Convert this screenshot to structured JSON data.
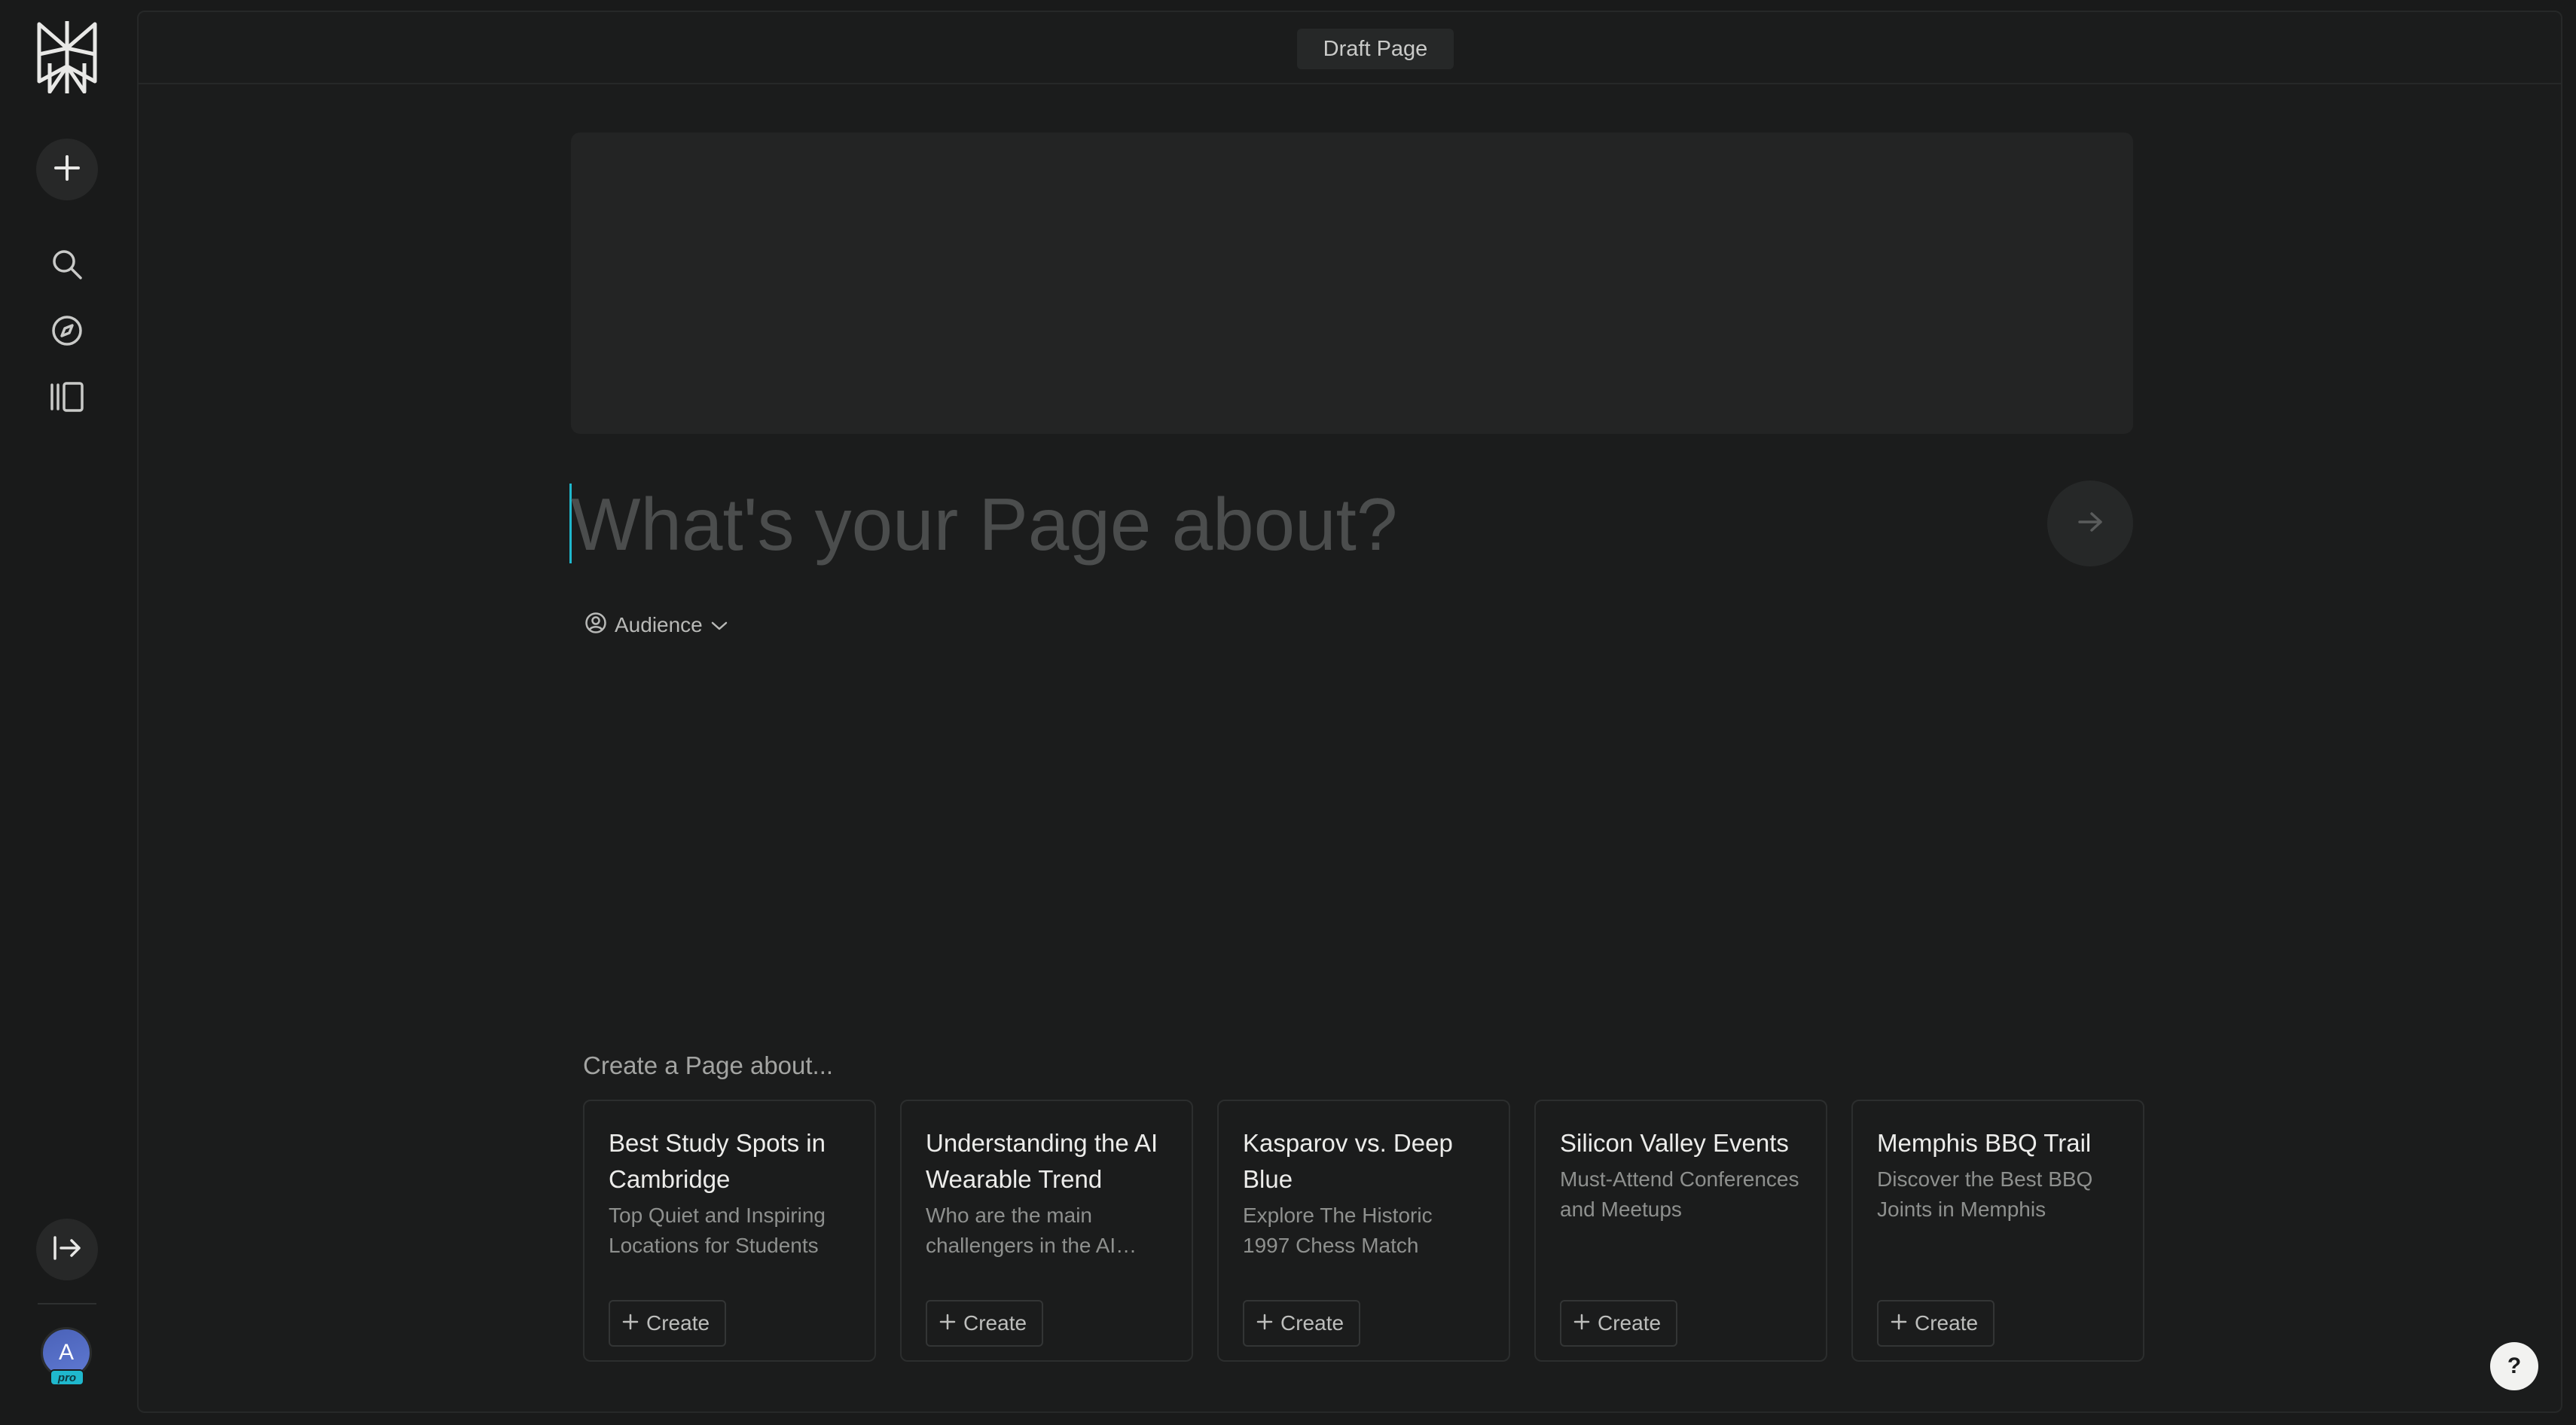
{
  "sidebar": {
    "logo_icon": "perplexity-logo",
    "new_icon": "plus-icon",
    "nav": [
      {
        "icon": "search-icon"
      },
      {
        "icon": "compass-icon"
      },
      {
        "icon": "library-icon"
      }
    ],
    "collapse_icon": "expand-sidebar-icon",
    "avatar_letter": "A",
    "badge": "pro"
  },
  "header": {
    "title": "Draft Page"
  },
  "editor": {
    "placeholder": "What's your Page about?",
    "value": "",
    "submit_icon": "arrow-right-icon",
    "audience_label": "Audience",
    "audience_icon": "user-circle-icon",
    "audience_chevron": "chevron-down-icon"
  },
  "suggestions": {
    "heading": "Create a Page about...",
    "button_label": "Create",
    "cards": [
      {
        "title": "Best Study Spots in Cambridge",
        "desc": "Top Quiet and Inspiring Locations for Students"
      },
      {
        "title": "Understanding the AI Wearable Trend",
        "desc": "Who are the main challengers in the AI wearable space?"
      },
      {
        "title": "Kasparov vs. Deep Blue",
        "desc": "Explore The Historic 1997 Chess Match"
      },
      {
        "title": "Silicon Valley Events",
        "desc": "Must-Attend Conferences and Meetups"
      },
      {
        "title": "Memphis BBQ Trail",
        "desc": "Discover the Best BBQ Joints in Memphis"
      }
    ]
  },
  "help": {
    "label": "?"
  },
  "colors": {
    "background": "#191a1a",
    "panel": "#1b1c1c",
    "accent": "#1fb8cd",
    "avatar": "#5f79d2"
  }
}
